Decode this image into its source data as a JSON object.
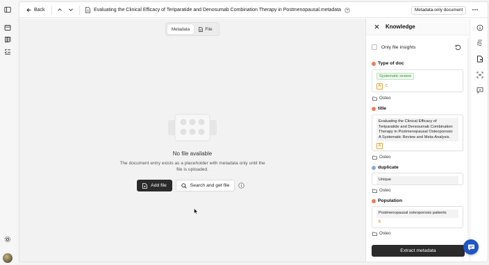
{
  "rail": {
    "icons": [
      "sidebar-toggle-icon",
      "library-icon",
      "books-icon",
      "checklist-icon",
      "settings-icon"
    ],
    "avatar": "user-avatar"
  },
  "topbar": {
    "back_label": "Back",
    "doc_title": "Evaluating the Clinical Efficacy of Teriparatide and Denosumab Combination Therapy in Postmenopausal.metadata",
    "badge": "Metadata-only document"
  },
  "view_toggle": {
    "metadata_label": "Metadata",
    "file_label": "File",
    "selected": "Metadata"
  },
  "empty_state": {
    "title": "No file available",
    "description": "The document entry exists as a placeholder with metadata only until the file is uploaded.",
    "add_file_label": "Add file",
    "search_label": "Search and get file"
  },
  "knowledge": {
    "title": "Knowledge",
    "filter_label": "Only file insights",
    "filter_checked": false,
    "fields": [
      {
        "label": "Type of doc",
        "value": "Systematic review",
        "sources": [
          "A",
          "C"
        ],
        "tag": "Osteo",
        "status_color": "#f07a5a"
      },
      {
        "label": "title",
        "value": "Evaluating the Clinical Efficacy of Teriparatide and Denosumab Combination Therapy in Postmenopausal Osteoporosis: A Systematic Review and Meta-Analysis.",
        "sources": [
          "A"
        ],
        "tag": "Osteo",
        "status_color": "#f07a5a"
      },
      {
        "label": "duplicate",
        "value": "Unique",
        "sources": [],
        "tag": "Osteo",
        "status_color": "#8fa9d8"
      },
      {
        "label": "Population",
        "value": "Postmenopausal osteoporosis patients",
        "sources": [
          "B"
        ],
        "tag": "Osteo",
        "status_color": "#f07a5a"
      }
    ],
    "extract_label": "Extract metadata"
  },
  "right_bar": {
    "icons": [
      "info-icon",
      "document-outline-icon",
      "knowledge-icon",
      "scan-icon",
      "comment-icon"
    ]
  },
  "colors": {
    "primary_button": "#2b2b2b",
    "chat_fab": "#1f55c7",
    "status_orange": "#f07a5a",
    "status_blue": "#8fa9d8",
    "chip_green": "#3a8a3a"
  }
}
